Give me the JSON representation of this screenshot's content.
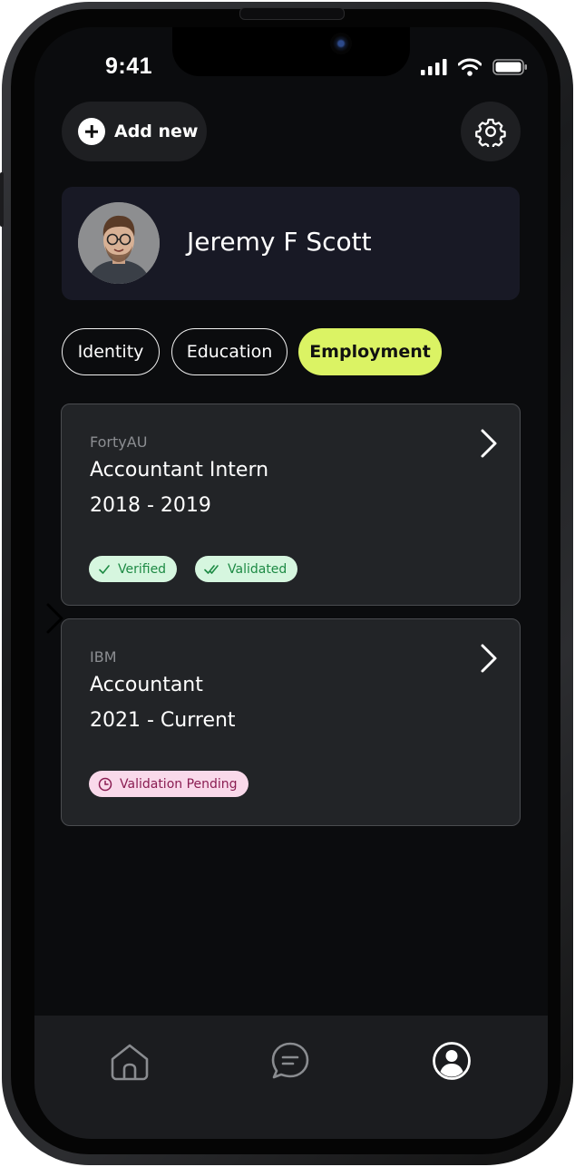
{
  "status_bar": {
    "time": "9:41"
  },
  "header": {
    "add_new_label": "Add new"
  },
  "profile": {
    "name": "Jeremy F Scott"
  },
  "tabs": [
    {
      "label": "Identity",
      "active": false
    },
    {
      "label": "Education",
      "active": false
    },
    {
      "label": "Employment",
      "active": true
    }
  ],
  "employment": [
    {
      "company": "FortyAU",
      "title": "Accountant Intern",
      "dates": "2018 - 2019",
      "badges": [
        {
          "label": "Verified",
          "icon": "check-icon",
          "tone": "green"
        },
        {
          "label": "Validated",
          "icon": "double-check-icon",
          "tone": "green"
        }
      ]
    },
    {
      "company": "IBM",
      "title": "Accountant",
      "dates": "2021 - Current",
      "badges": [
        {
          "label": "Validation Pending",
          "icon": "clock-icon",
          "tone": "pink"
        }
      ]
    }
  ],
  "bottom_nav": [
    {
      "icon": "home-icon",
      "active": false
    },
    {
      "icon": "chat-icon",
      "active": false
    },
    {
      "icon": "profile-icon",
      "active": true
    }
  ],
  "colors": {
    "accent": "#dbf364",
    "background": "#0b0c0e",
    "card": "#222427",
    "verified_bg": "#d6f6df",
    "pending_bg": "#f9d9ea"
  }
}
